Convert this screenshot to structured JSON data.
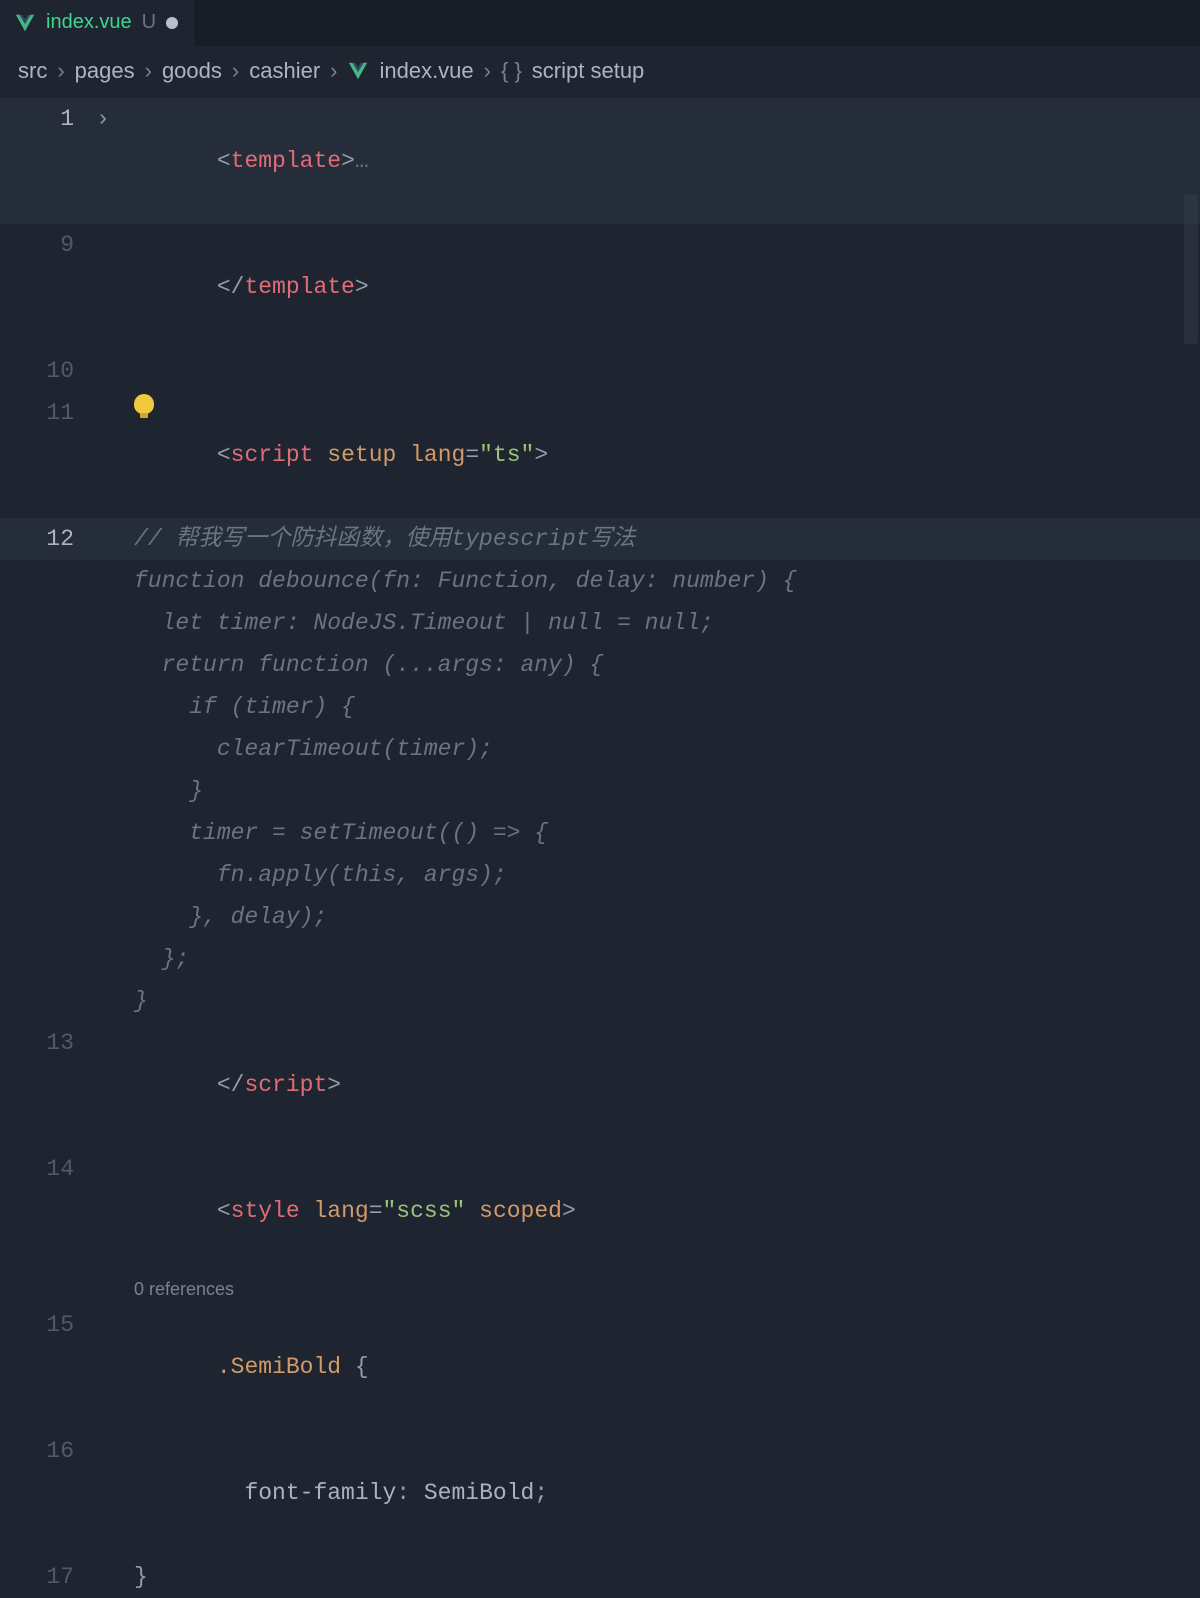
{
  "tab": {
    "filename": "index.vue",
    "status": "U"
  },
  "breadcrumb": {
    "parts": [
      "src",
      "pages",
      "goods",
      "cashier",
      "index.vue",
      "script setup"
    ],
    "sep": "›"
  },
  "gutter": {
    "l1": "1",
    "l9": "9",
    "l10": "10",
    "l11": "11",
    "l12": "12",
    "l13": "13",
    "l14": "14",
    "l15": "15",
    "l16": "16",
    "l17": "17"
  },
  "code": {
    "l1": {
      "open": "<",
      "tag": "template",
      "close": ">",
      "ellipsis": "…"
    },
    "l9": {
      "open": "</",
      "tag": "template",
      "close": ">"
    },
    "l11": {
      "open": "<",
      "tag": "script",
      "sp": " ",
      "attr1": "setup",
      "attr2": "lang",
      "eq": "=",
      "str": "\"ts\"",
      "close": ">"
    },
    "l12": "// 帮我写一个防抖函数，使用typescript写法",
    "ghost": [
      "function debounce(fn: Function, delay: number) {",
      "  let timer: NodeJS.Timeout | null = null;",
      "  return function (...args: any) {",
      "    if (timer) {",
      "      clearTimeout(timer);",
      "    }",
      "    timer = setTimeout(() => {",
      "      fn.apply(this, args);",
      "    }, delay);",
      "  };",
      "}"
    ],
    "l13": {
      "open": "</",
      "tag": "script",
      "close": ">"
    },
    "l14": {
      "open": "<",
      "tag": "style",
      "sp": " ",
      "attr1": "lang",
      "eq": "=",
      "str": "\"scss\"",
      "attr2": "scoped",
      "close": ">"
    },
    "codelens": "0 references",
    "l15": {
      "dot": ".",
      "sel": "SemiBold",
      "sp": " ",
      "brace": "{"
    },
    "l16": {
      "indent": "  ",
      "prop": "font-family",
      "colon": ": ",
      "val": "SemiBold",
      "semi": ";"
    },
    "l17": {
      "brace": "}"
    }
  }
}
